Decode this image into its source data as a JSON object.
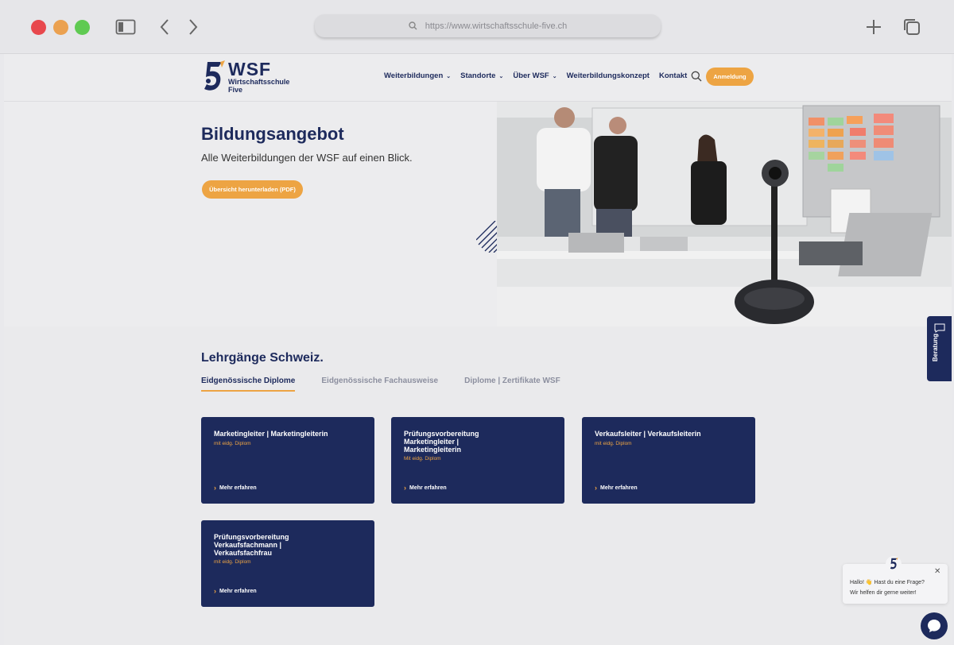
{
  "browser": {
    "url": "https://www.wirtschaftsschule-five.ch"
  },
  "header": {
    "logo_title": "WSF",
    "logo_sub_1": "Wirtschaftsschule",
    "logo_sub_2": "Five",
    "nav": [
      {
        "label": "Weiterbildungen",
        "chevron": "⌄"
      },
      {
        "label": "Standorte",
        "chevron": "⌄"
      },
      {
        "label": "Über WSF",
        "chevron": "⌄"
      },
      {
        "label": "Weiterbildungskonzept",
        "chevron": ""
      },
      {
        "label": "Kontakt",
        "chevron": ""
      }
    ],
    "cta_label": "Anmeldung"
  },
  "hero": {
    "title": "Bildungsangebot",
    "subtitle": "Alle Weiterbildungen der WSF auf einen Blick.",
    "button_label": "Übersicht herunterladen (PDF)"
  },
  "section": {
    "title": "Lehrgänge Schweiz.",
    "tabs": [
      {
        "label": "Eidgenössische Diplome"
      },
      {
        "label": "Eidgenössische Fachausweise"
      },
      {
        "label": "Diplome | Zertifikate WSF"
      }
    ],
    "cards": [
      {
        "title": "Marketingleiter | Marketingleiterin",
        "sub": "mit eidg. Diplom",
        "link": "Mehr erfahren"
      },
      {
        "title": "Prüfungsvorbereitung Marketingleiter | Marketingleiterin",
        "sub": "Mit eidg. Diplom",
        "link": "Mehr erfahren"
      },
      {
        "title": "Verkaufsleiter | Verkaufsleiterin",
        "sub": "mit eidg. Diplom",
        "link": "Mehr erfahren"
      },
      {
        "title": "Prüfungsvorbereitung Verkaufsfachmann | Verkaufsfachfrau",
        "sub": "mit eidg. Diplom",
        "link": "Mehr erfahren"
      }
    ]
  },
  "side_tab": {
    "label": "Beratung"
  },
  "chat": {
    "line1": "Hallo! 👋 Hast du eine Frage?",
    "line2": "Wir helfen dir gerne weiter!"
  },
  "colors": {
    "navy": "#1d2a5c",
    "accent": "#eda443",
    "page_bg": "#eaeaec"
  },
  "icons": [
    "sidebar-icon",
    "back-icon",
    "forward-icon",
    "search-icon",
    "plus-icon",
    "tabs-icon",
    "chat-icon",
    "close-icon"
  ]
}
